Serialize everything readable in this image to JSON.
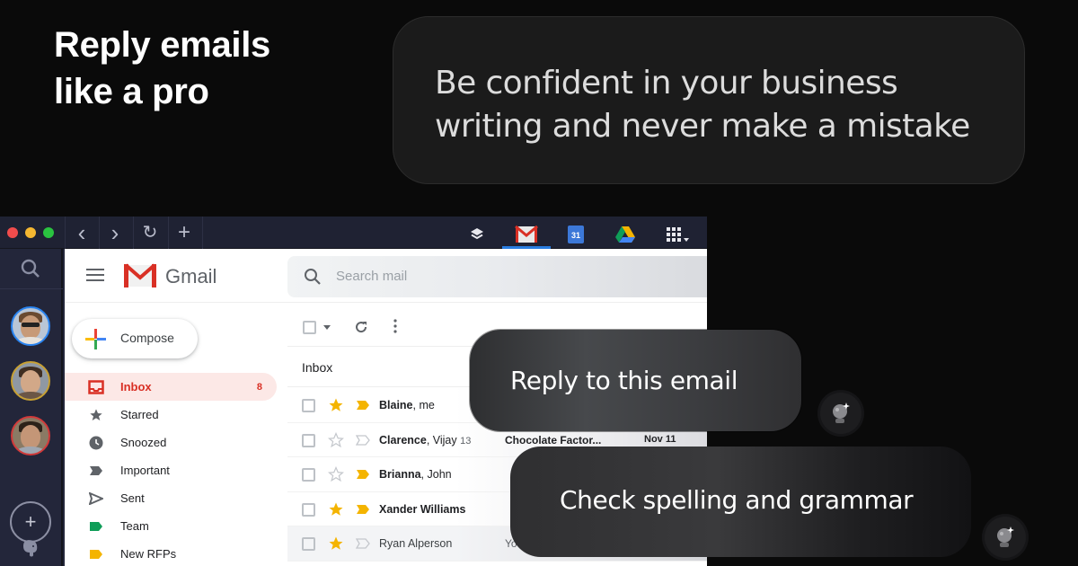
{
  "hero": {
    "headline_lines": [
      "Reply emails",
      "like a pro"
    ],
    "tagline_lines": [
      "Be confident in your business",
      "writing and never make a mistake"
    ]
  },
  "browser": {
    "window_controls": [
      "close",
      "minimize",
      "maximize"
    ],
    "nav_buttons": [
      {
        "icon": "chevron-left-icon",
        "glyph": "‹"
      },
      {
        "icon": "chevron-right-icon",
        "glyph": "›"
      },
      {
        "icon": "refresh-icon",
        "glyph": "↻"
      },
      {
        "icon": "plus-icon",
        "glyph": "+"
      }
    ],
    "app_tabs": [
      {
        "name": "layers",
        "active": false
      },
      {
        "name": "gmail",
        "active": true
      },
      {
        "name": "calendar",
        "label": "31",
        "active": false
      },
      {
        "name": "drive",
        "active": false
      },
      {
        "name": "apps-grid",
        "active": false
      }
    ],
    "active_tab_color": "#2a7de1",
    "rail": {
      "accounts": [
        {
          "ring_color": "#2a84f0"
        },
        {
          "ring_color": "#c7a033"
        },
        {
          "ring_color": "#d23a3a"
        }
      ],
      "add_label": "+"
    }
  },
  "gmail": {
    "app_name": "Gmail",
    "search_placeholder": "Search mail",
    "compose_label": "Compose",
    "nav": [
      {
        "label": "Inbox",
        "count": "8",
        "active": true,
        "icon": "inbox-icon"
      },
      {
        "label": "Starred",
        "icon": "star-icon"
      },
      {
        "label": "Snoozed",
        "icon": "clock-icon"
      },
      {
        "label": "Important",
        "icon": "important-icon"
      },
      {
        "label": "Sent",
        "icon": "send-icon"
      },
      {
        "label": "Team",
        "icon": "label-icon",
        "color": "#0f9d58"
      },
      {
        "label": "New RFPs",
        "icon": "label-icon",
        "color": "#f4b400"
      }
    ],
    "inbox_tab_label": "Inbox",
    "emails": [
      {
        "sender_bold": "Blaine",
        "sender_rest": ", me",
        "count": "",
        "starred": true,
        "important": true,
        "subject": "",
        "date": "",
        "read": false
      },
      {
        "sender_bold": "Clarence",
        "sender_rest": ", Vijay",
        "count": "13",
        "starred": false,
        "important": false,
        "subject": "Chocolate Factor...",
        "date": "Nov 11",
        "read": false
      },
      {
        "sender_bold": "Brianna",
        "sender_rest": ", John",
        "count": "",
        "starred": false,
        "important": true,
        "subject": "",
        "date": "",
        "read": false
      },
      {
        "sender_bold": "Xander Williams",
        "sender_rest": "",
        "count": "",
        "starred": true,
        "important": true,
        "subject": "",
        "date": "",
        "read": false
      },
      {
        "sender_bold": "",
        "sender_rest": "Ryan Alperson",
        "count": "",
        "starred": true,
        "important": false,
        "subject": "You",
        "date": "",
        "read": true
      }
    ],
    "accent": "#d93025",
    "star_color": "#f4b400"
  },
  "prompts": {
    "reply": "Reply to this email",
    "check": "Check spelling and grammar"
  }
}
